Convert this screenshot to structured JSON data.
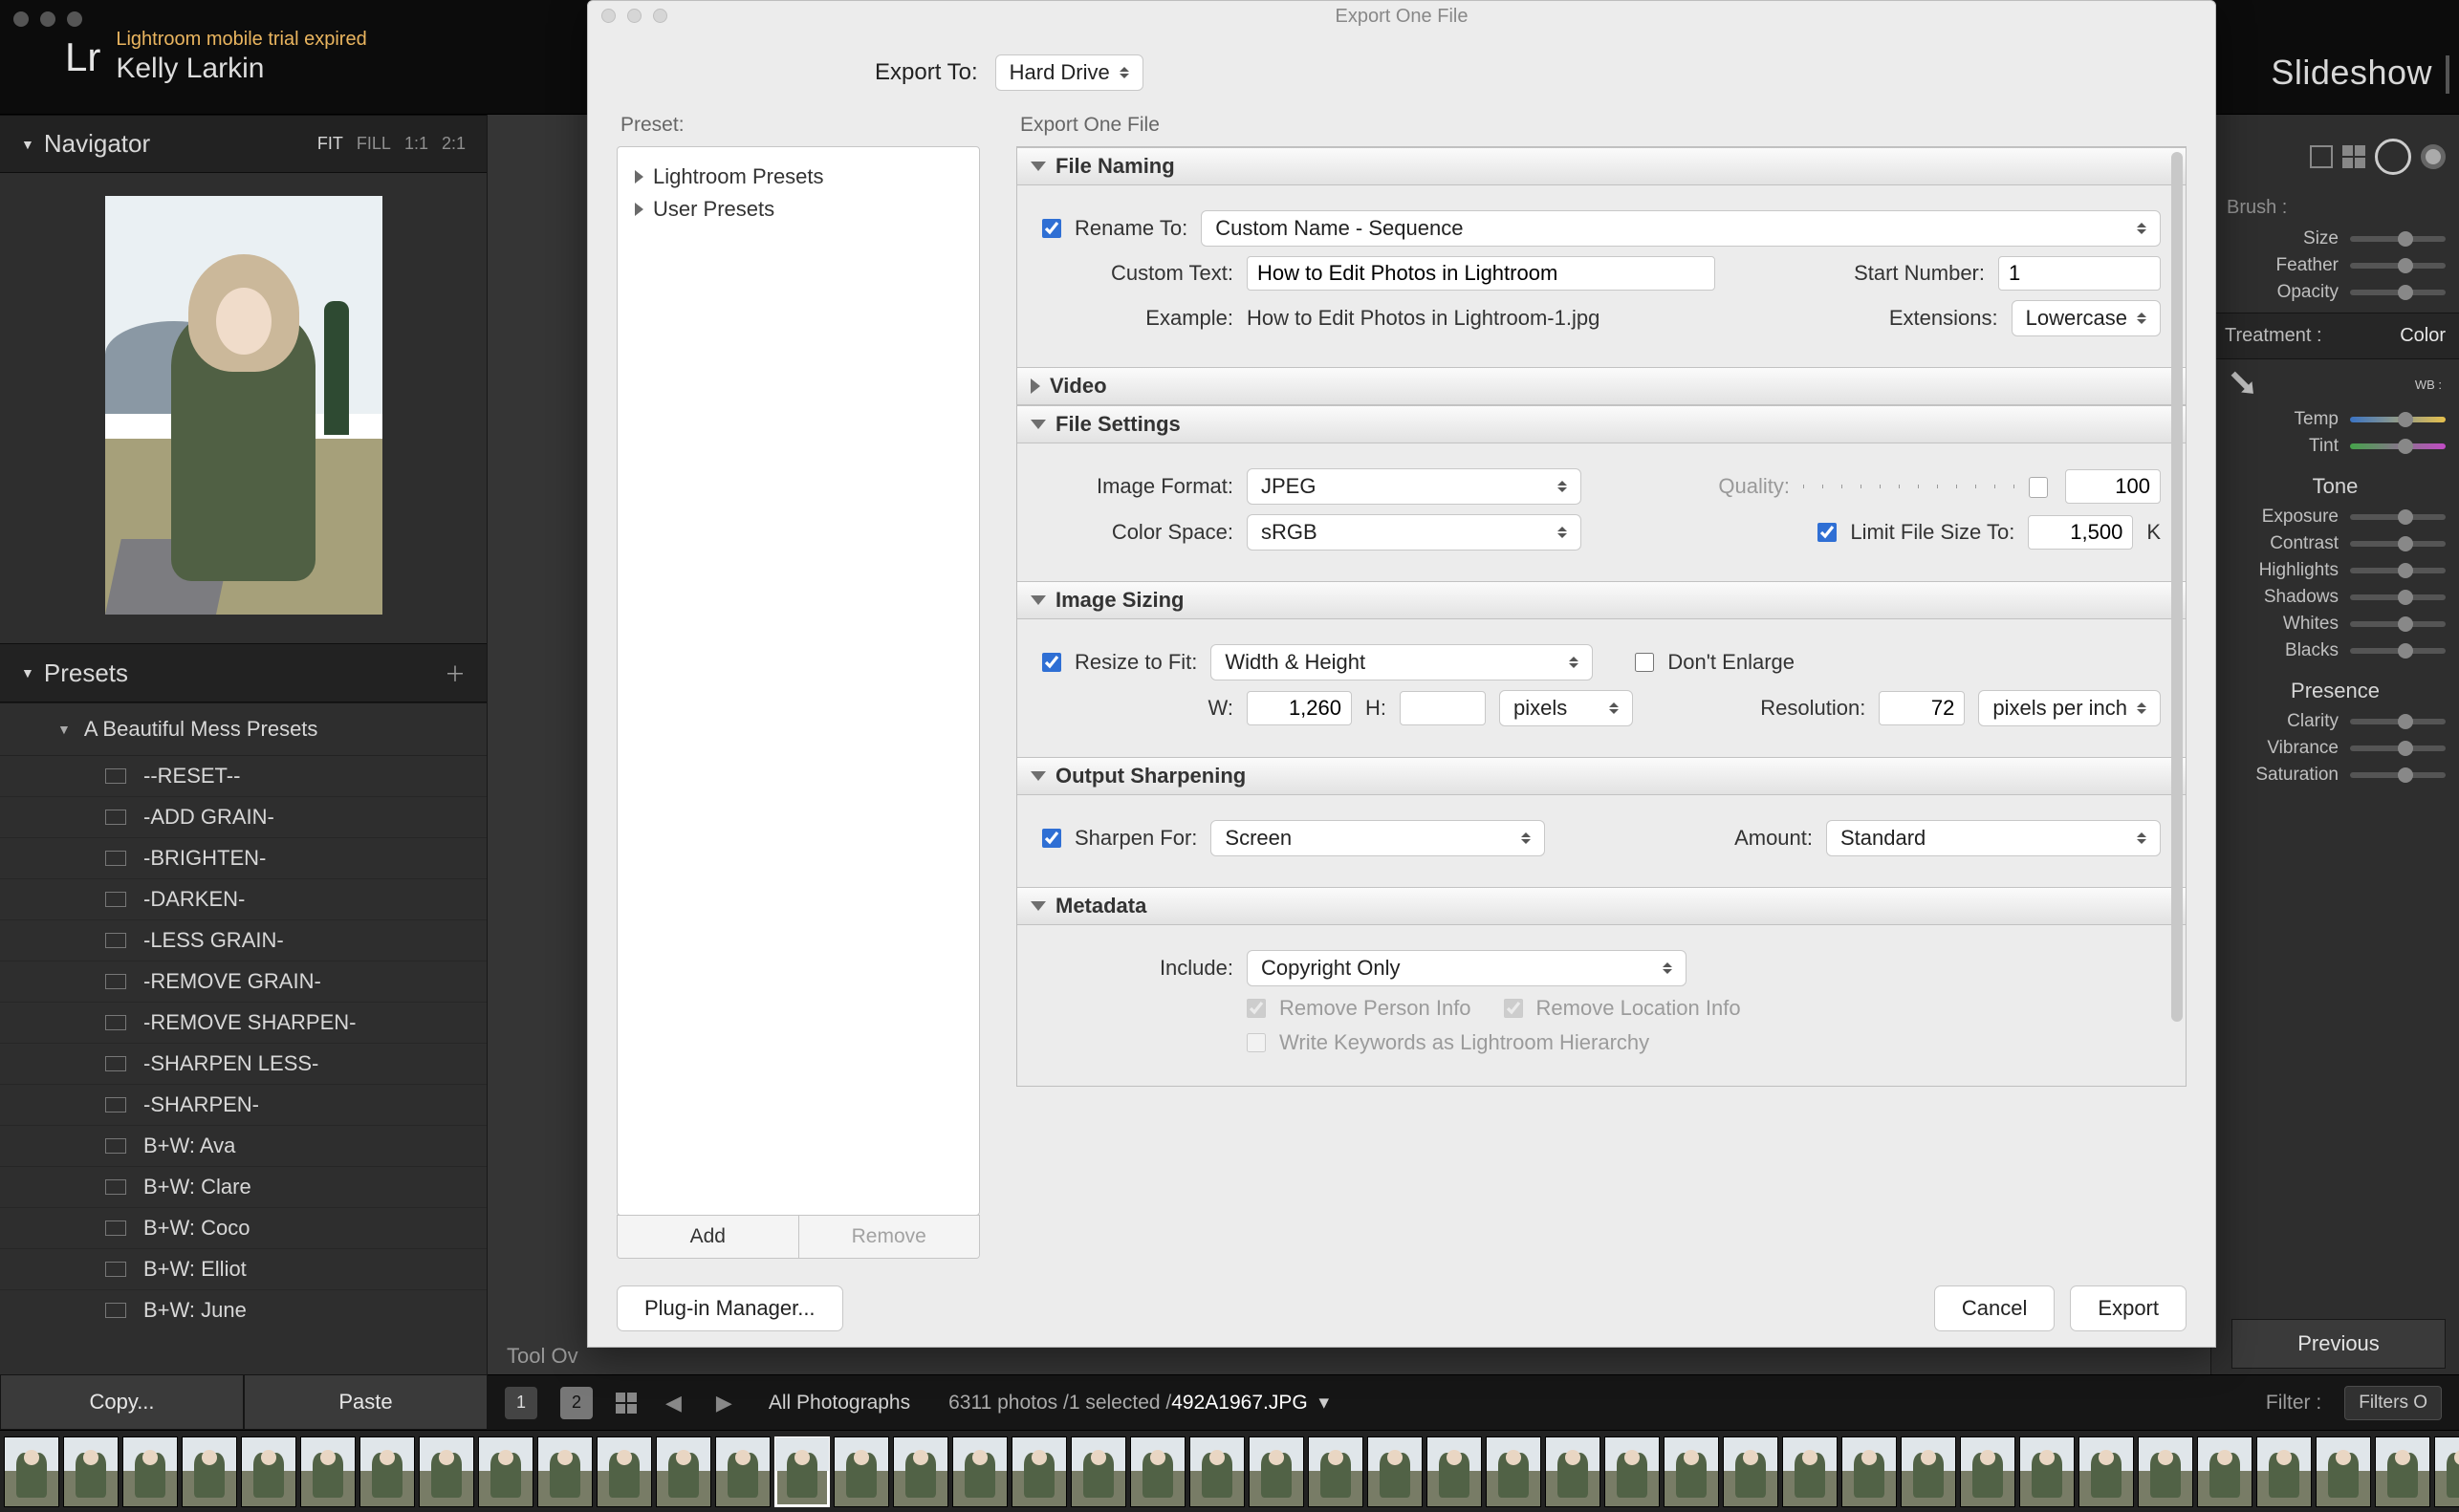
{
  "lightroom": {
    "trial_text": "Lightroom mobile trial expired",
    "user_name": "Kelly Larkin",
    "logo": "Lr",
    "right_module": "Slideshow",
    "navigator": {
      "title": "Navigator",
      "views": [
        "FIT",
        "FILL",
        "1:1",
        "2:1"
      ],
      "active_view": "FIT"
    },
    "presets_panel": {
      "title": "Presets",
      "group_label": "A Beautiful Mess Presets",
      "items": [
        "--RESET--",
        "-ADD GRAIN-",
        "-BRIGHTEN-",
        "-DARKEN-",
        "-LESS GRAIN-",
        "-REMOVE GRAIN-",
        "-REMOVE SHARPEN-",
        "-SHARPEN LESS-",
        "-SHARPEN-",
        "B+W: Ava",
        "B+W: Clare",
        "B+W: Coco",
        "B+W: Elliot",
        "B+W: June"
      ]
    },
    "copy_label": "Copy...",
    "paste_label": "Paste",
    "tool_overlay_text": "Tool Ov",
    "toolbar": {
      "collection": "All Photographs",
      "count_text": "6311 photos /1 selected /",
      "filename": "492A1967.JPG",
      "filter_label": "Filter :",
      "filters_off": "Filters O",
      "secondary_label": "2"
    },
    "right_panel": {
      "brush_label": "Brush :",
      "size_label": "Size",
      "feather_label": "Feather",
      "opacity_label": "Opacity",
      "treatment_label": "Treatment :",
      "treatment_value": "Color",
      "wb_label": "WB :",
      "temp_label": "Temp",
      "tint_label": "Tint",
      "tone_title": "Tone",
      "exposure_label": "Exposure",
      "contrast_label": "Contrast",
      "highlights_label": "Highlights",
      "shadows_label": "Shadows",
      "whites_label": "Whites",
      "blacks_label": "Blacks",
      "presence_title": "Presence",
      "clarity_label": "Clarity",
      "vibrance_label": "Vibrance",
      "saturation_label": "Saturation",
      "previous_label": "Previous"
    }
  },
  "modal": {
    "title": "Export One File",
    "export_to_label": "Export To:",
    "export_to_value": "Hard Drive",
    "preset_label": "Preset:",
    "preset_header": "Export One File",
    "preset_groups": [
      "Lightroom Presets",
      "User Presets"
    ],
    "add_label": "Add",
    "remove_label": "Remove",
    "sections": {
      "file_naming": {
        "title": "File Naming",
        "rename_to_label": "Rename To:",
        "rename_to_value": "Custom Name - Sequence",
        "custom_text_label": "Custom Text:",
        "custom_text_value": "How to Edit Photos in Lightroom",
        "start_number_label": "Start Number:",
        "start_number_value": "1",
        "example_label": "Example:",
        "example_value": "How to Edit Photos in Lightroom-1.jpg",
        "extensions_label": "Extensions:",
        "extensions_value": "Lowercase"
      },
      "video": {
        "title": "Video"
      },
      "file_settings": {
        "title": "File Settings",
        "format_label": "Image Format:",
        "format_value": "JPEG",
        "quality_label": "Quality:",
        "quality_value": "100",
        "color_space_label": "Color Space:",
        "color_space_value": "sRGB",
        "limit_label": "Limit File Size To:",
        "limit_value": "1,500",
        "limit_unit": "K"
      },
      "image_sizing": {
        "title": "Image Sizing",
        "resize_label": "Resize to Fit:",
        "resize_value": "Width & Height",
        "dont_enlarge_label": "Don't Enlarge",
        "w_label": "W:",
        "w_value": "1,260",
        "h_label": "H:",
        "h_value": "",
        "units_value": "pixels",
        "resolution_label": "Resolution:",
        "resolution_value": "72",
        "resolution_units": "pixels per inch"
      },
      "output_sharpening": {
        "title": "Output Sharpening",
        "sharpen_label": "Sharpen For:",
        "sharpen_value": "Screen",
        "amount_label": "Amount:",
        "amount_value": "Standard"
      },
      "metadata": {
        "title": "Metadata",
        "include_label": "Include:",
        "include_value": "Copyright Only",
        "remove_person_label": "Remove Person Info",
        "remove_location_label": "Remove Location Info",
        "write_keywords_label": "Write Keywords as Lightroom Hierarchy"
      }
    },
    "plugin_mgr_label": "Plug-in Manager...",
    "cancel_label": "Cancel",
    "export_label": "Export"
  },
  "filmstrip": {
    "count": 42,
    "selected_index": 13
  }
}
